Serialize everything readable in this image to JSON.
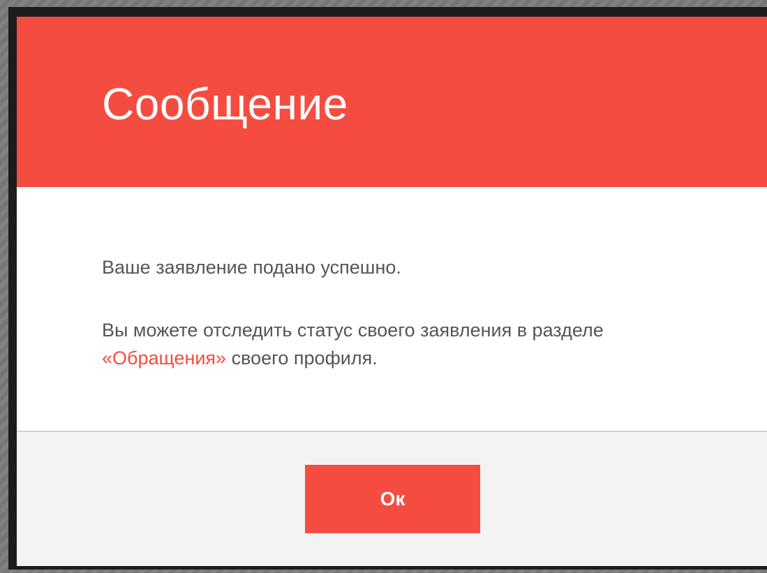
{
  "modal": {
    "title": "Сообщение",
    "message_line1": "Ваше заявление подано успешно.",
    "message_line2_prefix": "Вы можете отследить статус своего заявления в разделе ",
    "message_line2_link": "«Обращения»",
    "message_line2_suffix": " своего профиля.",
    "ok_label": "Ок"
  },
  "colors": {
    "accent": "#f54c41",
    "body_text": "#555555",
    "footer_bg": "#f3f3f3"
  }
}
